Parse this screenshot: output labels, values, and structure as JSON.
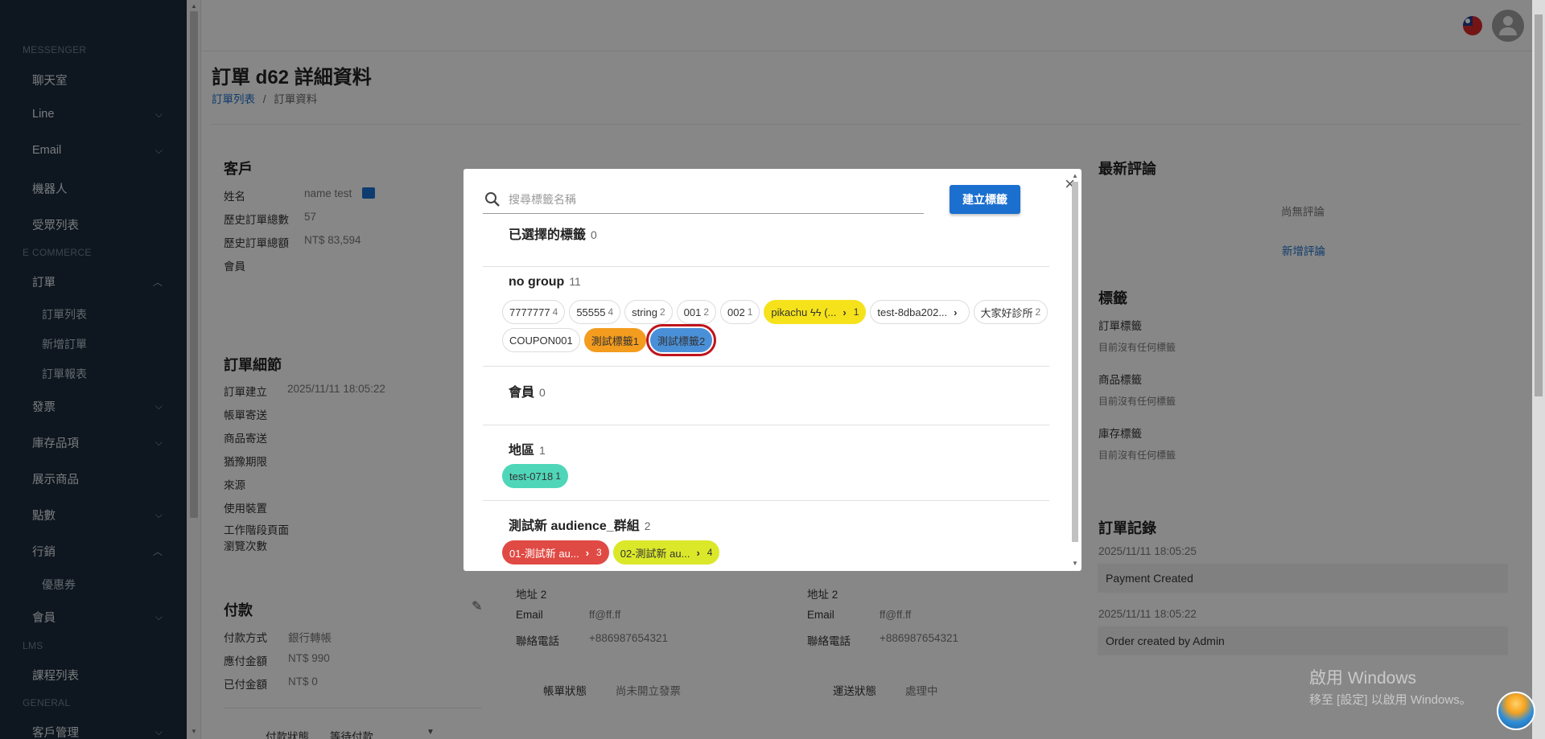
{
  "sidebar": {
    "sections": [
      "MESSENGER",
      "E COMMERCE",
      "LMS",
      "GENERAL"
    ],
    "items": {
      "chatroom": "聊天室",
      "line": "Line",
      "email": "Email",
      "bot": "機器人",
      "audience": "受眾列表",
      "orders": "訂單",
      "order_list": "訂單列表",
      "new_order": "新增訂單",
      "order_report": "訂單報表",
      "invoice": "發票",
      "inventory": "庫存品項",
      "showcase": "展示商品",
      "points": "點數",
      "marketing": "行銷",
      "coupon": "優惠券",
      "members": "會員",
      "courses": "課程列表",
      "customers": "客戶管理"
    }
  },
  "page": {
    "title": "訂單 d62 詳細資料",
    "breadcrumb_link": "訂單列表",
    "breadcrumb_sep": "/",
    "breadcrumb_current": "訂單資料"
  },
  "customer": {
    "heading": "客戶",
    "name_label": "姓名",
    "name_value": "name test",
    "total_orders_label": "歷史訂單總數",
    "total_orders_value": "57",
    "total_amount_label": "歷史訂單總額",
    "total_amount_value": "NT$ 83,594",
    "member_label": "會員"
  },
  "order_detail": {
    "heading": "訂單細節",
    "created_label": "訂單建立",
    "created_value": "2025/11/11 18:05:22",
    "billing_label": "帳單寄送",
    "shipping_label": "商品寄送",
    "grace_label": "猶豫期限",
    "source_label": "來源",
    "device_label": "使用裝置",
    "session_label": "工作階段頁面\n瀏覽次數"
  },
  "payment": {
    "heading": "付款",
    "method_label": "付款方式",
    "method_value": "銀行轉帳",
    "due_label": "應付金額",
    "due_value": "NT$ 990",
    "paid_label": "已付金額",
    "paid_value": "NT$ 0",
    "status_label": "付款狀態",
    "status_value": "等待付款"
  },
  "billing_col": {
    "addr2": "地址 2",
    "email_label": "Email",
    "email_value": "ff@ff.ff",
    "phone_label": "聯絡電話",
    "phone_value": "+886987654321",
    "status_label": "帳單狀態",
    "status_value": "尚未開立發票"
  },
  "shipping_col": {
    "addr2": "地址 2",
    "email_label": "Email",
    "email_value": "ff@ff.ff",
    "phone_label": "聯絡電話",
    "phone_value": "+886987654321",
    "status_label": "運送狀態",
    "status_value": "處理中"
  },
  "reviews": {
    "heading": "最新評論",
    "empty": "尚無評論",
    "add": "新增評論"
  },
  "tags_panel": {
    "heading": "標籤",
    "order_tags": "訂單標籤",
    "product_tags": "商品標籤",
    "stock_tags": "庫存標籤",
    "none": "目前沒有任何標籤"
  },
  "history": {
    "heading": "訂單記錄",
    "t1": "2025/11/11 18:05:25",
    "e1": "Payment Created",
    "t2": "2025/11/11 18:05:22",
    "e2": "Order created by Admin"
  },
  "watermark": {
    "line1": "啟用 Windows",
    "line2": "移至 [設定] 以啟用 Windows。"
  },
  "modal": {
    "search_placeholder": "搜尋標籤名稱",
    "create_button": "建立標籤",
    "close": "×",
    "selected": {
      "title": "已選擇的標籤",
      "count": "0"
    },
    "groups": [
      {
        "title": "no group",
        "count": "11",
        "chips": [
          {
            "label": "7777777",
            "n": "4"
          },
          {
            "label": "55555",
            "n": "4"
          },
          {
            "label": "string",
            "n": "2"
          },
          {
            "label": "001",
            "n": "2"
          },
          {
            "label": "002",
            "n": "1"
          },
          {
            "label": "pikachu ϟϟ (...",
            "arrow": "›",
            "n": "1",
            "color": "#f5e21a"
          },
          {
            "label": "test-8dba202...",
            "arrow": "›"
          },
          {
            "label": "大家好診所",
            "n": "2"
          },
          {
            "label": "COUPON001"
          },
          {
            "label": "測試標籤1",
            "color": "#f39c1e"
          },
          {
            "label": "測試標籤2",
            "color": "#4a90d9",
            "highlighted": true
          }
        ]
      },
      {
        "title": "會員",
        "count": "0",
        "chips": []
      },
      {
        "title": "地區",
        "count": "1",
        "chips": [
          {
            "label": "test-0718",
            "n": "1",
            "color": "#4fd6b8"
          }
        ]
      },
      {
        "title": "測試新 audience_群組",
        "count": "2",
        "chips": [
          {
            "label": "01-測試新 au...",
            "arrow": "›",
            "n": "3",
            "color": "#e04a44"
          },
          {
            "label": "02-測試新 au...",
            "arrow": "›",
            "n": "4",
            "color": "#dbe82a"
          }
        ]
      }
    ]
  }
}
